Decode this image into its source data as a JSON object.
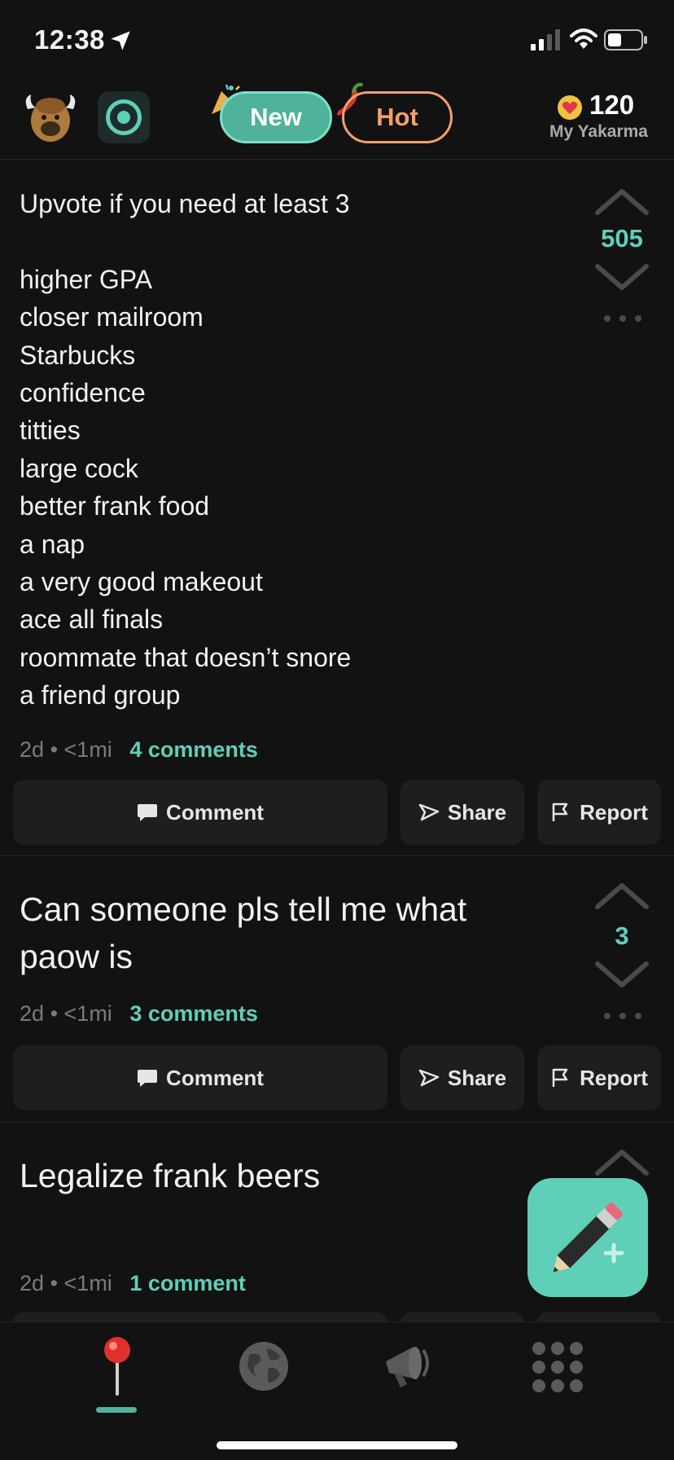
{
  "status_bar": {
    "time": "12:38"
  },
  "header": {
    "tab_new": "New",
    "tab_hot": "Hot",
    "yakarma_value": "120",
    "yakarma_label": "My Yakarma"
  },
  "posts": [
    {
      "text": "Upvote if you need at least 3\n\nhigher GPA\ncloser mailroom\nStarbucks\nconfidence\ntitties\nlarge cock\nbetter frank food\na nap\na very good makeout\nace all finals\nroommate that doesn’t snore\na friend group",
      "votes": "505",
      "age": "2d",
      "distance": "<1mi",
      "comments": "4 comments"
    },
    {
      "text": "Can someone pls tell me what\npaow is",
      "votes": "3",
      "age": "2d",
      "distance": "<1mi",
      "comments": "3 comments"
    },
    {
      "text": "Legalize frank beers",
      "votes": "",
      "age": "2d",
      "distance": "<1mi",
      "comments": "1 comment"
    }
  ],
  "actions": {
    "comment": "Comment",
    "share": "Share",
    "report": "Report"
  },
  "meta_separator": "•",
  "colors": {
    "accent": "#5fcfb8",
    "hot": "#f1a06a",
    "background": "#121212",
    "button_bg": "#1e1e1e"
  }
}
